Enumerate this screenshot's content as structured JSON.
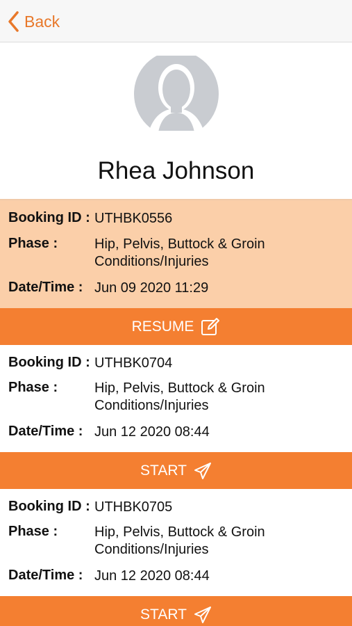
{
  "nav": {
    "back_label": "Back"
  },
  "profile": {
    "name": "Rhea Johnson"
  },
  "labels": {
    "booking_id": "Booking ID :",
    "phase": "Phase :",
    "datetime": "Date/Time :"
  },
  "bookings": [
    {
      "id": "UTHBK0556",
      "phase": "Hip, Pelvis, Buttock & Groin Conditions/Injuries",
      "datetime": "Jun 09 2020 11:29",
      "action": "RESUME",
      "action_icon": "edit-icon",
      "highlighted": true
    },
    {
      "id": "UTHBK0704",
      "phase": "Hip, Pelvis, Buttock & Groin Conditions/Injuries",
      "datetime": "Jun 12 2020 08:44",
      "action": "START",
      "action_icon": "paper-plane-icon",
      "highlighted": false
    },
    {
      "id": "UTHBK0705",
      "phase": "Hip, Pelvis, Buttock & Groin Conditions/Injuries",
      "datetime": "Jun 12 2020 08:44",
      "action": "START",
      "action_icon": "paper-plane-icon",
      "highlighted": false
    }
  ],
  "colors": {
    "accent": "#f47f31",
    "highlight": "#fbcfa9",
    "back": "#e8782a"
  }
}
